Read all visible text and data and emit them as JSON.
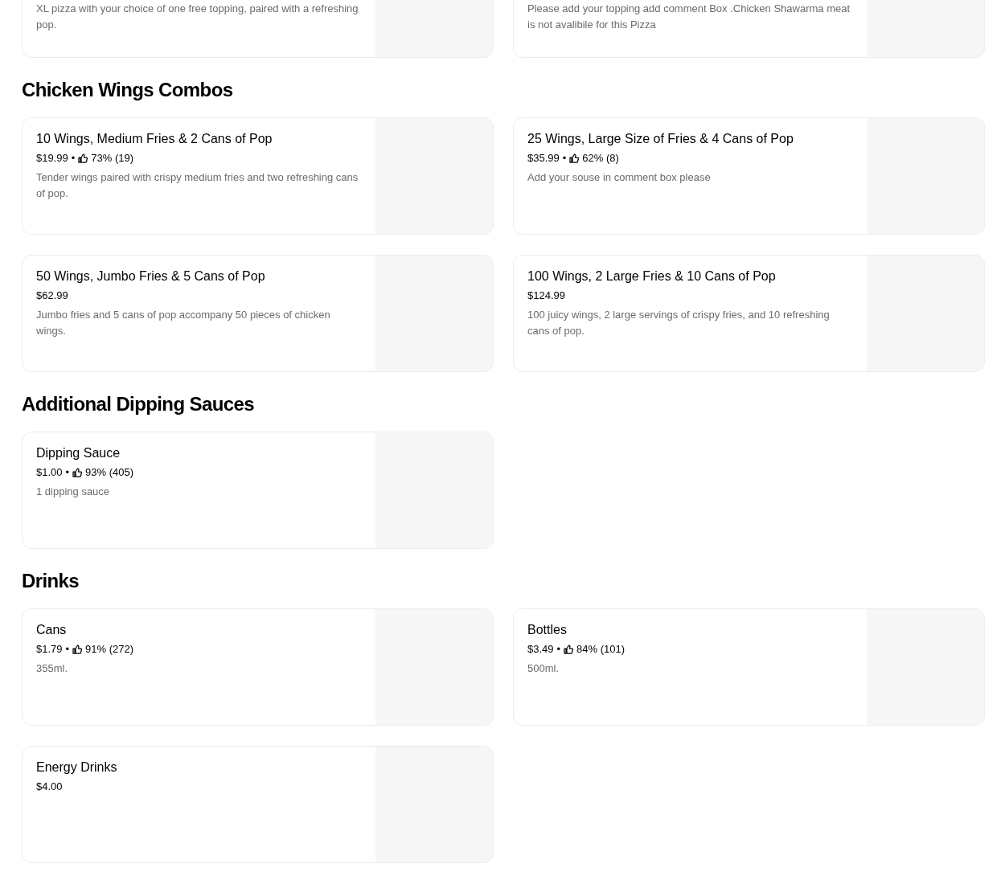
{
  "sections": [
    {
      "items": [
        {
          "description": "XL pizza with your choice of one free topping, paired with a refreshing pop."
        },
        {
          "description": "Please add your topping add comment Box .Chicken Shawarma meat is not avalibile for this Pizza"
        }
      ]
    },
    {
      "title": "Chicken Wings Combos",
      "items": [
        {
          "name": "10 Wings, Medium Fries & 2 Cans of Pop",
          "price": "$19.99",
          "separator": "•",
          "rating": "73% (19)",
          "description": "Tender wings paired with crispy medium fries and two refreshing cans of pop."
        },
        {
          "name": "25 Wings, Large Size of Fries & 4 Cans of Pop",
          "price": "$35.99",
          "separator": "•",
          "rating": "62% (8)",
          "description": "Add your souse in comment box please"
        },
        {
          "name": "50 Wings, Jumbo Fries & 5 Cans of Pop",
          "price": "$62.99",
          "description": "Jumbo fries and 5 cans of pop accompany 50 pieces of chicken wings."
        },
        {
          "name": "100 Wings, 2 Large Fries & 10 Cans of Pop",
          "price": "$124.99",
          "description": "100 juicy wings, 2 large servings of crispy fries, and 10 refreshing cans of pop."
        }
      ]
    },
    {
      "title": "Additional Dipping Sauces",
      "items": [
        {
          "name": "Dipping Sauce",
          "price": "$1.00",
          "separator": "•",
          "rating": "93% (405)",
          "description": "1 dipping sauce"
        }
      ]
    },
    {
      "title": "Drinks",
      "items": [
        {
          "name": "Cans",
          "price": "$1.79",
          "separator": "•",
          "rating": "91% (272)",
          "description": "355ml."
        },
        {
          "name": "Bottles",
          "price": "$3.49",
          "separator": "•",
          "rating": "84% (101)",
          "description": "500ml."
        },
        {
          "name": "Energy Drinks",
          "price": "$4.00"
        }
      ]
    }
  ]
}
